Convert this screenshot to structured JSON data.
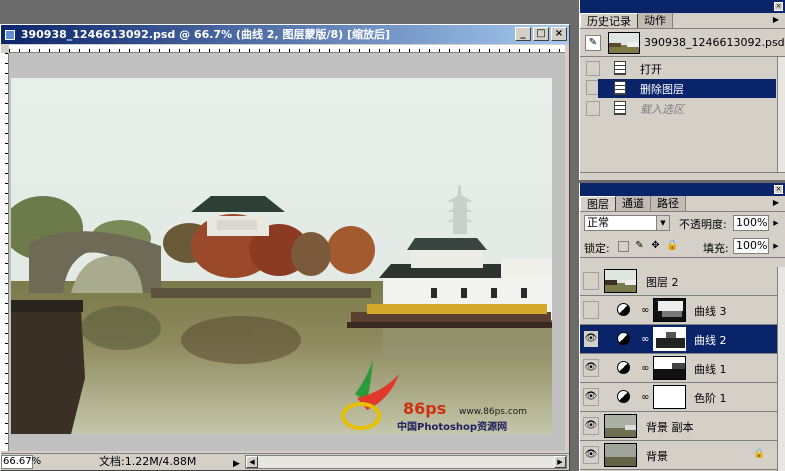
{
  "document": {
    "title": "390938_1246613092.psd @ 66.7% (曲线 2, 图层蒙版/8) [缩放后]",
    "buttons": {
      "minimize": "_",
      "maximize": "□",
      "close": "×"
    },
    "status": {
      "zoom": "66.67%",
      "doc_info": "文档:1.22M/4.88M"
    },
    "watermark": {
      "brand": "86ps",
      "url": "www.86ps.com",
      "site_name": "中国Photoshop资源网"
    }
  },
  "history_panel": {
    "tabs": [
      {
        "label": "历史记录"
      },
      {
        "label": "动作"
      }
    ],
    "snapshot_label": "390938_1246613092.psd",
    "items": [
      {
        "label": "打开"
      },
      {
        "label": "删除图层"
      },
      {
        "label": "载入选区"
      }
    ]
  },
  "layers_panel": {
    "tabs": [
      {
        "label": "图层"
      },
      {
        "label": "通道"
      },
      {
        "label": "路径"
      }
    ],
    "blend_mode": "正常",
    "opacity_label": "不透明度:",
    "opacity_value": "100%",
    "lock_label": "锁定:",
    "fill_label": "填充:",
    "fill_value": "100%",
    "layers": [
      {
        "name": "图层 2",
        "visible": false,
        "selected": false
      },
      {
        "name": "曲线 3",
        "visible": false,
        "selected": false
      },
      {
        "name": "曲线 2",
        "visible": true,
        "selected": true
      },
      {
        "name": "曲线 1",
        "visible": true,
        "selected": false
      },
      {
        "name": "色阶 1",
        "visible": true,
        "selected": false
      },
      {
        "name": "背景 副本",
        "visible": true,
        "selected": false
      },
      {
        "name": "背景",
        "visible": true,
        "selected": false
      }
    ]
  },
  "colors": {
    "title_active": "#0a246a",
    "panel_bg": "#d4d0c8",
    "selection": "#0a246a"
  }
}
